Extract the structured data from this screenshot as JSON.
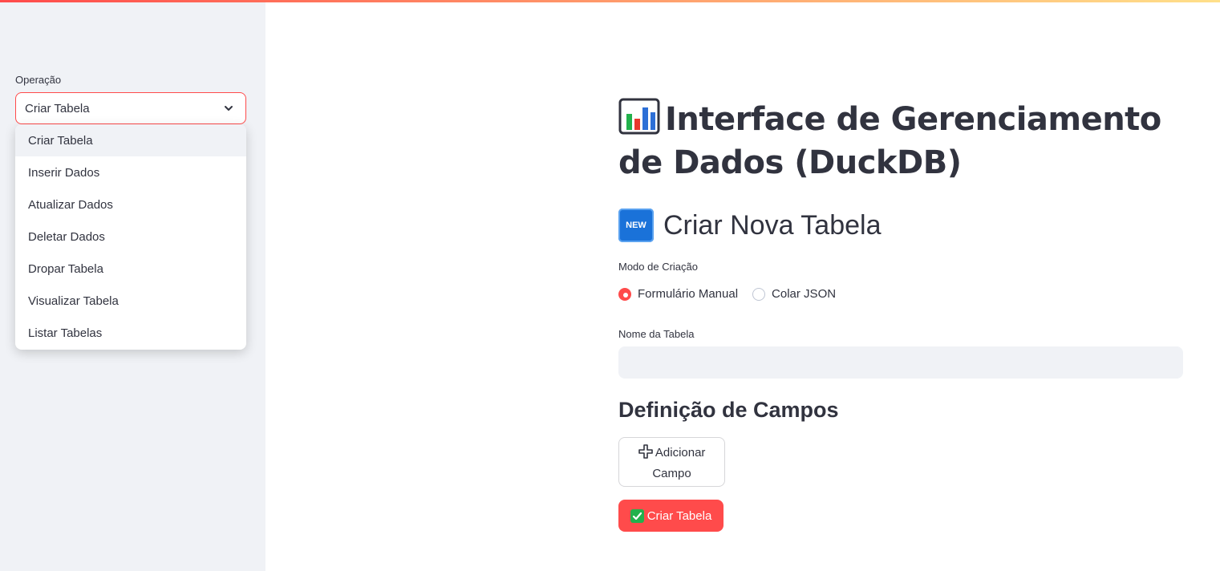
{
  "sidebar": {
    "label": "Operação",
    "selected": "Criar Tabela",
    "options": [
      "Criar Tabela",
      "Inserir Dados",
      "Atualizar Dados",
      "Deletar Dados",
      "Dropar Tabela",
      "Visualizar Tabela",
      "Listar Tabelas"
    ]
  },
  "main": {
    "title": "Interface de Gerenciamento de Dados (DuckDB)",
    "subtitle": "Criar Nova Tabela",
    "new_badge": "NEW",
    "mode_label": "Modo de Criação",
    "mode_options": [
      "Formulário Manual",
      "Colar JSON"
    ],
    "mode_selected": "Formulário Manual",
    "name_label": "Nome da Tabela",
    "name_value": "",
    "fields_heading": "Definição de Campos",
    "add_field_button": "Adicionar Campo",
    "create_button": "Criar Tabela"
  },
  "colors": {
    "accent": "#ff4b4b",
    "sidebar_bg": "#f0f2f6",
    "text": "#31333f"
  },
  "icons": [
    "bar-chart-icon",
    "new-icon",
    "plus-icon",
    "check-icon",
    "chevron-down-icon"
  ]
}
